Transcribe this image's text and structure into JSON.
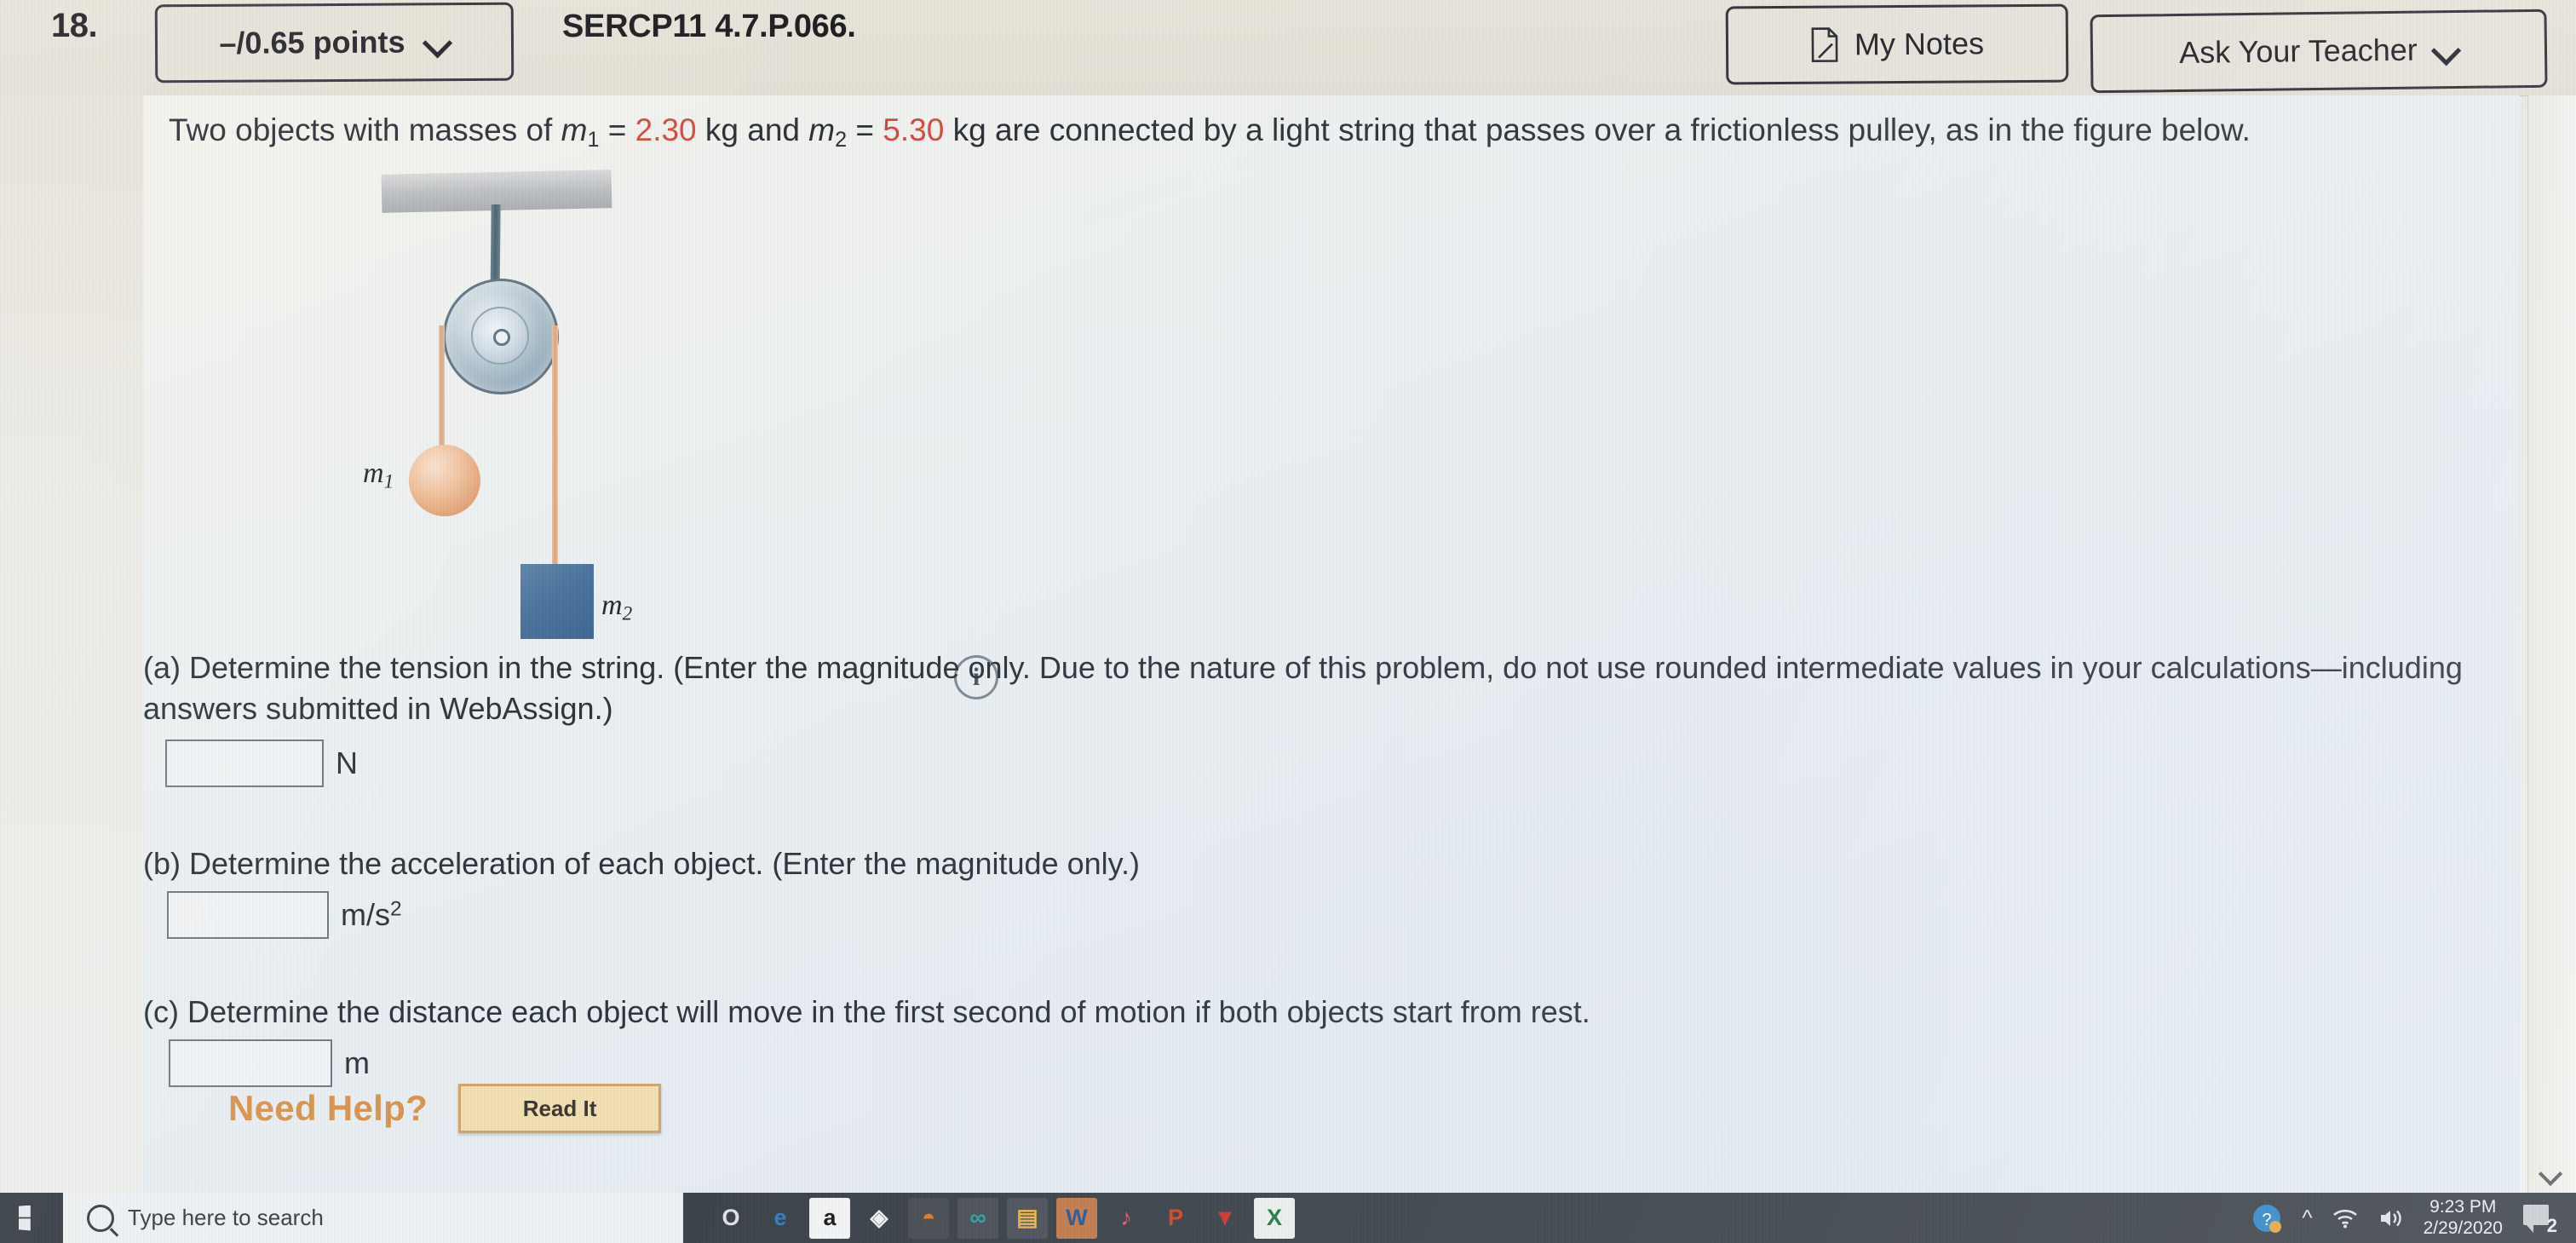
{
  "header": {
    "question_number": "18.",
    "points_label": "–/0.65 points",
    "points_chevron_icon": "chevron-down-icon",
    "question_code": "SERCP11 4.7.P.066.",
    "my_notes_label": "My Notes",
    "my_notes_icon": "note-page-icon",
    "ask_teacher_label": "Ask Your Teacher",
    "ask_teacher_chevron_icon": "chevron-down-icon"
  },
  "question": {
    "prefix": "Two objects with masses of ",
    "m1_symbol": "m",
    "m1_sub": "1",
    "eq": " = ",
    "m1_value": "2.30",
    "mid1": " kg and ",
    "m2_symbol": "m",
    "m2_sub": "2",
    "m2_value": "5.30",
    "suffix": " kg are connected by a light string that passes over a frictionless pulley, as in the figure below."
  },
  "figure": {
    "m1_label": "m",
    "m1_sub": "1",
    "m2_label": "m",
    "m2_sub": "2",
    "info_icon": "info-icon",
    "info_glyph": "i",
    "colors": {
      "ceiling": "#b9bcbf",
      "pulley": "#9fb4c3",
      "string": "#d9a379",
      "sphere_m1": "#e2a477",
      "block_m2": "#4a729c"
    }
  },
  "parts": [
    {
      "id": "a",
      "text": "(a) Determine the tension in the string. (Enter the magnitude only. Due to the nature of this problem, do not use rounded intermediate values in your calculations—including answers submitted in WebAssign.)",
      "answer_value": "",
      "unit": "N"
    },
    {
      "id": "b",
      "text": "(b) Determine the acceleration of each object. (Enter the magnitude only.)",
      "answer_value": "",
      "unit_base": "m/s",
      "unit_exp": "2"
    },
    {
      "id": "c",
      "text": "(c) Determine the distance each object will move in the first second of motion if both objects start from rest.",
      "answer_value": "",
      "unit": "m"
    }
  ],
  "need_help": {
    "label": "Need Help?",
    "read_it_label": "Read It",
    "accent_color": "#d9944f"
  },
  "scrollbar": {
    "down_arrow_icon": "chevron-down-icon"
  },
  "taskbar": {
    "start_icon": "windows-logo-icon",
    "search_placeholder": "Type here to search",
    "search_icon": "magnifier-icon",
    "apps": [
      {
        "name": "cortana-icon",
        "glyph": "O",
        "bg": "#3a4048",
        "fg": "#dfe3e7"
      },
      {
        "name": "edge-icon",
        "glyph": "e",
        "bg": "#3a4048",
        "fg": "#2f7cc4"
      },
      {
        "name": "adobe-acrobat-icon",
        "glyph": "a",
        "bg": "#f3f4f5",
        "fg": "#1a1a1a"
      },
      {
        "name": "dropbox-icon",
        "glyph": "◈",
        "bg": "#3a4048",
        "fg": "#f2f4f6"
      },
      {
        "name": "firefox-icon",
        "glyph": "◓",
        "bg": "#474b52",
        "fg": "#e8761f"
      },
      {
        "name": "office-icon",
        "glyph": "∞",
        "bg": "#4a4e55",
        "fg": "#2aa3a3"
      },
      {
        "name": "file-explorer-icon",
        "glyph": "▤",
        "bg": "#4d5159",
        "fg": "#e8b64a"
      },
      {
        "name": "word-icon",
        "glyph": "W",
        "bg": "#c17a4a",
        "fg": "#2b5797"
      },
      {
        "name": "itunes-icon",
        "glyph": "♪",
        "bg": "#3a4048",
        "fg": "#e8556f"
      },
      {
        "name": "powerpoint-icon",
        "glyph": "P",
        "bg": "#3a4048",
        "fg": "#d04423"
      },
      {
        "name": "app-red-icon",
        "glyph": "▼",
        "bg": "#3a4048",
        "fg": "#c8372a"
      },
      {
        "name": "excel-icon",
        "glyph": "X",
        "bg": "#eef1ec",
        "fg": "#1f7a43"
      }
    ],
    "tray": {
      "help_icon": "help-circle-icon",
      "show_hidden_icon": "chevron-up-icon",
      "wifi_icon": "wifi-icon",
      "volume_icon": "speaker-icon",
      "time": "9:23 PM",
      "date": "2/29/2020",
      "notifications_icon": "notification-bubble-icon",
      "notifications_count": "2"
    }
  }
}
